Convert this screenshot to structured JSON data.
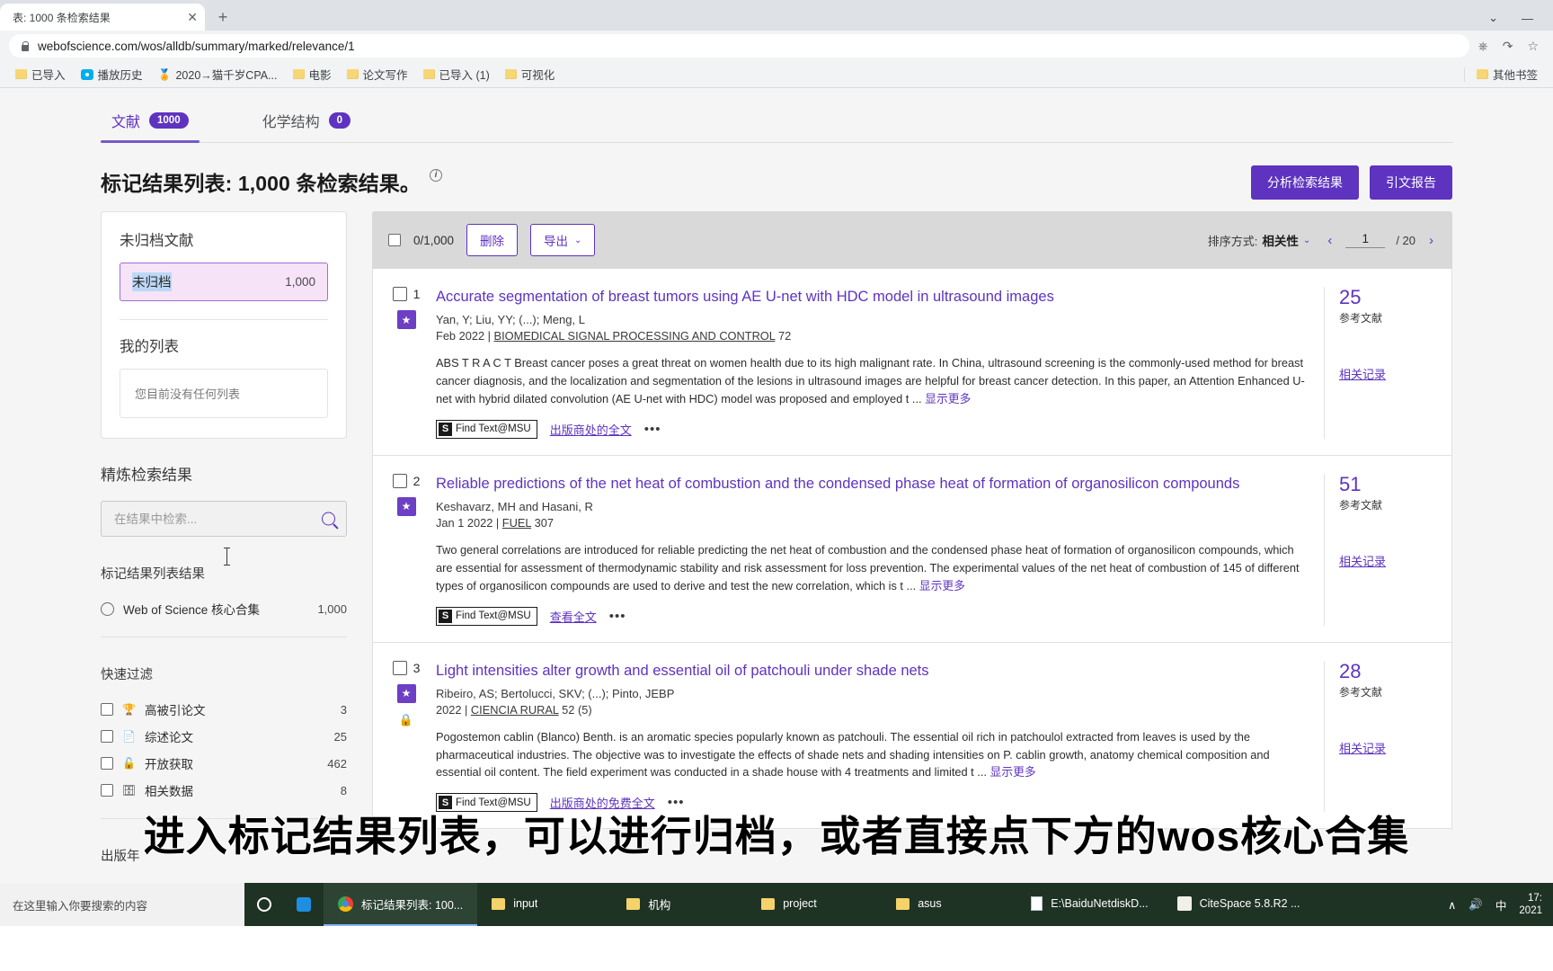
{
  "browser": {
    "tab_title": "表: 1000 条检索结果",
    "tab_close": "✕",
    "new_tab": "+",
    "url": "webofscience.com/wos/alldb/summary/marked/relevance/1",
    "window_controls": {
      "chevron": "⌄",
      "minimize": "—"
    },
    "toolbar_icons": {
      "translate": "⎈",
      "share": "↷",
      "star": "☆"
    },
    "bookmarks": [
      {
        "label": "已导入",
        "icon": "folder"
      },
      {
        "label": "播放历史",
        "icon": "bilibili"
      },
      {
        "label": "2020→猫千岁CPA...",
        "icon": "medal"
      },
      {
        "label": "电影",
        "icon": "folder"
      },
      {
        "label": "论文写作",
        "icon": "folder"
      },
      {
        "label": "已导入 (1)",
        "icon": "folder"
      },
      {
        "label": "可视化",
        "icon": "folder"
      }
    ],
    "other_bookmarks": "其他书签"
  },
  "tabs": [
    {
      "label": "文献",
      "count": "1000",
      "active": true
    },
    {
      "label": "化学结构",
      "count": "0",
      "active": false
    }
  ],
  "header": {
    "title": "标记结果列表: 1,000 条检索结果。",
    "info_icon": "i",
    "analyze_button": "分析检索结果",
    "citation_report_button": "引文报告"
  },
  "sidebar": {
    "unfiled_heading": "未归档文献",
    "unfiled_item": {
      "label": "未归档",
      "count": "1,000"
    },
    "my_lists_heading": "我的列表",
    "my_lists_empty": "您目前没有任何列表",
    "refine_heading": "精炼检索结果",
    "search_placeholder": "在结果中检索...",
    "search_value": "",
    "marked_results_heading": "标记结果列表结果",
    "database_option": {
      "label": "Web of Science 核心合集",
      "count": "1,000"
    },
    "quick_filters_heading": "快速过滤",
    "quick_filters": [
      {
        "icon": "🏆",
        "label": "高被引论文",
        "count": "3"
      },
      {
        "icon": "📄",
        "label": "综述论文",
        "count": "25"
      },
      {
        "icon": "🔓",
        "label": "开放获取",
        "count": "462"
      },
      {
        "icon": "🗄",
        "label": "相关数据",
        "count": "8"
      }
    ],
    "publication_years_heading": "出版年"
  },
  "results_toolbar": {
    "selected": "0/1,000",
    "delete_button": "删除",
    "export_button": "导出",
    "export_chevron": "⌄",
    "sort_label": "排序方式:",
    "sort_value": "相关性",
    "sort_chevron": "⌄",
    "prev_arrow": "‹",
    "next_arrow": "›",
    "page_value": "1",
    "page_total": "/ 20"
  },
  "records": [
    {
      "num": "1",
      "badge": "star",
      "title": "Accurate segmentation of breast tumors using AE U-net with HDC model in ultrasound images",
      "authors": "Yan, Y; Liu, YY; (...); Meng, L",
      "meta_date": "Feb 2022",
      "meta_journal": "BIOMEDICAL SIGNAL PROCESSING AND CONTROL",
      "meta_vol": "72",
      "abstract": "ABS T R A C T Breast cancer poses a great threat on women health due to its high malignant rate. In China, ultrasound screening is the commonly-used method for breast cancer diagnosis, and the localization and segmentation of the lesions in ultrasound images are helpful for breast cancer detection. In this paper, an Attention Enhanced U-net with hybrid dilated convolution (AE U-net with HDC) model was proposed and employed t ...",
      "show_more": "显示更多",
      "find_text": "Find Text@MSU",
      "fulltext_link": "出版商处的全文",
      "dots": "•••",
      "cite_count": "25",
      "cite_label": "参考文献",
      "related": "相关记录"
    },
    {
      "num": "2",
      "badge": "star",
      "title": "Reliable predictions of the net heat of combustion and the condensed phase heat of formation of organosilicon compounds",
      "authors": "Keshavarz, MH and Hasani, R",
      "meta_date": "Jan 1 2022",
      "meta_journal": "FUEL",
      "meta_vol": "307",
      "abstract": "Two general correlations are introduced for reliable predicting the net heat of combustion and the condensed phase heat of formation of organosilicon compounds, which are essential for assessment of thermodynamic stability and risk assessment for loss prevention. The experimental values of the net heat of combustion of 145 of different types of organosilicon compounds are used to derive and test the new correlation, which is t ...",
      "show_more": "显示更多",
      "find_text": "Find Text@MSU",
      "fulltext_link": "查看全文",
      "dots": "•••",
      "cite_count": "51",
      "cite_label": "参考文献",
      "related": "相关记录"
    },
    {
      "num": "3",
      "badge": "lock",
      "title": "Light intensities alter growth and essential oil of patchouli under shade nets",
      "authors": "Ribeiro, AS; Bertolucci, SKV; (...); Pinto, JEBP",
      "meta_date": "2022",
      "meta_journal": "CIENCIA RURAL",
      "meta_vol": "52 (5)",
      "abstract": "Pogostemon cablin (Blanco) Benth. is an aromatic species popularly known as patchouli. The essential oil rich in patchoulol extracted from leaves is used by the pharmaceutical industries. The objective was to investigate the effects of shade nets and shading intensities on P. cablin growth, anatomy chemical composition and essential oil content. The field experiment was conducted in a shade house with 4 treatments and limited t ...",
      "show_more": "显示更多",
      "find_text": "Find Text@MSU",
      "fulltext_link": "出版商处的免费全文",
      "dots": "•••",
      "cite_count": "28",
      "cite_label": "参考文献",
      "related": "相关记录"
    }
  ],
  "subtitle": "进入标记结果列表，可以进行归档，或者直接点下方的wos核心合集",
  "taskbar": {
    "search_placeholder": "在这里输入你要搜索的内容",
    "items": [
      {
        "label": "标记结果列表: 100...",
        "icon": "chrome",
        "active": true
      },
      {
        "label": "input",
        "icon": "folder",
        "active": false
      },
      {
        "label": "机构",
        "icon": "folder",
        "active": false
      },
      {
        "label": "project",
        "icon": "folder",
        "active": false
      },
      {
        "label": "asus",
        "icon": "folder",
        "active": false
      },
      {
        "label": "E:\\BaiduNetdiskD...",
        "icon": "doc",
        "active": false
      },
      {
        "label": "CiteSpace 5.8.R2 ...",
        "icon": "citespace",
        "active": false
      }
    ],
    "tray": {
      "chevron": "∧",
      "volume": "🔊",
      "ime": "中"
    },
    "clock_time": "17:",
    "clock_date": "2021"
  }
}
